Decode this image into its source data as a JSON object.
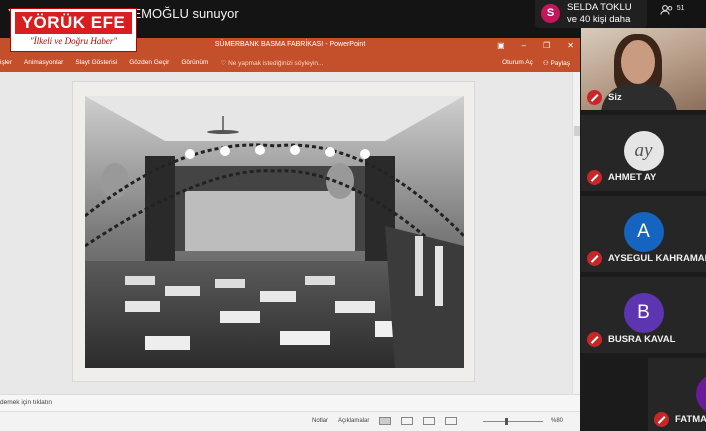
{
  "meeting": {
    "presenter_text": "YILMAZ ERDAL ERDEMOĞLU sunuyor",
    "participants_avatar_initial": "S",
    "participants_line1": "SELDA TOKLU",
    "participants_line2": "ve 40 kişi daha",
    "people_count": "51"
  },
  "logo": {
    "name": "YÖRÜK EFE",
    "tagline": "\"İlkeli ve Doğru Haber\""
  },
  "ppt": {
    "doc_title": "SÜMERBANK BASMA FABRİKASI - PowerPoint",
    "window_buttons": [
      "▣",
      "–",
      "❐",
      "✕"
    ],
    "tabs": [
      "işler",
      "Animasyonlar",
      "Slayt Gösterisi",
      "Gözden Geçir",
      "Görünüm"
    ],
    "tell_me": "♡ Ne yapmak istediğinizi söyleyin...",
    "open_label": "Oturum Aç",
    "share_label": "⚇ Paylaş",
    "notes_placeholder": "demek için tıklatın",
    "status": {
      "notes": "Notlar",
      "comments": "Açıklamalar",
      "zoom": "%80"
    }
  },
  "tiles": [
    {
      "type": "video",
      "name": "Siz"
    },
    {
      "type": "avatar",
      "name": "AHMET AY",
      "initial": "ay",
      "color": "#e5e5e5"
    },
    {
      "type": "avatar",
      "name": "AYSEGUL KAHRAMAN",
      "initial": "A",
      "color": "#1565c0"
    },
    {
      "type": "avatar",
      "name": "BUSRA KAVAL",
      "initial": "B",
      "color": "#5e35b1"
    },
    {
      "type": "avatar",
      "name": "FATMA",
      "initial": "",
      "color": "#6a1b9a"
    }
  ]
}
